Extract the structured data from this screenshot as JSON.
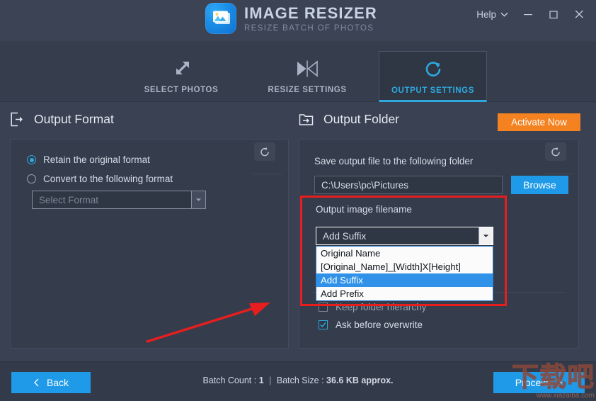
{
  "window": {
    "brand_title": "IMAGE RESIZER",
    "brand_subtitle": "RESIZE BATCH OF PHOTOS",
    "logo_icon": "photos-stack-icon",
    "help_label": "Help",
    "help_caret_icon": "chevron-down-icon",
    "minimize_icon": "minimize-icon",
    "maximize_icon": "maximize-icon",
    "close_icon": "close-icon"
  },
  "tabs": [
    {
      "label": "SELECT PHOTOS",
      "icon": "resize-diagonal-arrows-icon",
      "active": false
    },
    {
      "label": "RESIZE SETTINGS",
      "icon": "mirror-triangles-icon",
      "active": false
    },
    {
      "label": "OUTPUT SETTINGS",
      "icon": "refresh-circle-icon",
      "active": true
    }
  ],
  "activate": {
    "label": "Activate Now",
    "color": "#f58220"
  },
  "output_format": {
    "heading": "Output Format",
    "heading_icon": "export-box-icon",
    "reset_icon": "reset-arrow-icon",
    "options": [
      {
        "label": "Retain the original format",
        "selected": true
      },
      {
        "label": "Convert to the following format",
        "selected": false
      }
    ],
    "format_select": {
      "placeholder": "Select Format",
      "value": "",
      "caret_icon": "caret-down-icon"
    }
  },
  "output_folder": {
    "heading": "Output Folder",
    "heading_icon": "folder-import-icon",
    "reset_icon": "reset-arrow-icon",
    "save_label": "Save output file to the following folder",
    "path_value": "C:\\Users\\pc\\Pictures",
    "browse_label": "Browse",
    "filename_label": "Output image filename",
    "filename_select": {
      "value": "Add Suffix",
      "caret_icon": "caret-down-icon",
      "open": true,
      "options": [
        {
          "label": "Original Name",
          "selected": false
        },
        {
          "label": "[Original_Name]_[Width]X[Height]",
          "selected": false
        },
        {
          "label": "Add Suffix",
          "selected": true
        },
        {
          "label": "Add Prefix",
          "selected": false
        }
      ]
    },
    "checkboxes": [
      {
        "label": "Keep folder hierarchy",
        "checked": false
      },
      {
        "label": "Ask before overwrite",
        "checked": true
      }
    ]
  },
  "annotations": {
    "highlight_color": "#e81e1e",
    "arrow_icon": "red-pointer-arrow"
  },
  "footer": {
    "back_label": "Back",
    "back_icon": "chevron-left-icon",
    "batch_count_label": "Batch Count :",
    "batch_count_value": "1",
    "separator": "|",
    "batch_size_label": "Batch Size :",
    "batch_size_value": "36.6 KB approx.",
    "process_label": "Process",
    "process_icon": "chevron-right-icon"
  },
  "watermark": {
    "text_cn": "下载吧",
    "url": "www.xiazaiba.com"
  }
}
